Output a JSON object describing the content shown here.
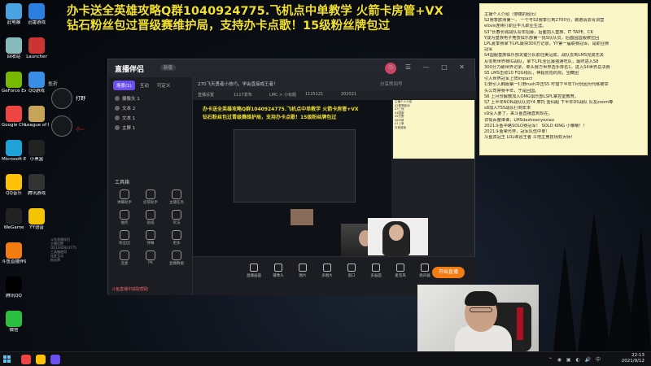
{
  "overlay": {
    "line1": "办卡送全英雄攻略Q群1040924775.飞机点中单教学 火箭卡房管+VX",
    "line2": "钻石粉丝包过晋级赛维护局，支持办卡点歌！15级粉丝牌包过"
  },
  "desktop_icons": [
    {
      "label": "此电脑",
      "color": "#4aa3e0"
    },
    {
      "label": "回收站",
      "color": "#8bb"
    },
    {
      "label": "GeForce Experience",
      "color": "#76b900"
    },
    {
      "label": "Google Chrome",
      "color": "#e44"
    },
    {
      "label": "Microsoft Edge",
      "color": "#1fa2d8"
    },
    {
      "label": "QQ音乐",
      "color": "#ffc107"
    },
    {
      "label": "WeGame",
      "color": "#222"
    },
    {
      "label": "斗鱼直播伴侣",
      "color": "#f27b12"
    },
    {
      "label": "腾讯QQ",
      "color": "#000"
    },
    {
      "label": "微信",
      "color": "#2bbd3f"
    }
  ],
  "desktop_icons_col2": [
    {
      "label": "迅雷游戏",
      "color": "#2a7fe0"
    },
    {
      "label": "Launcher",
      "color": "#c33"
    },
    {
      "label": "QQ游戏",
      "color": "#3a8ee6"
    },
    {
      "label": "League of Legends",
      "color": "#c8a45a"
    },
    {
      "label": "小黑盒",
      "color": "#222"
    },
    {
      "label": "腾讯游戏",
      "color": "#333"
    },
    {
      "label": "YY语音",
      "color": "#f5c400"
    }
  ],
  "float_badge": {
    "label1": "挫折",
    "label2": "打野",
    "label3": "小~"
  },
  "app": {
    "logo": "直播伴侣",
    "version": "新版",
    "tabs": [
      "场景(1)",
      "互动",
      "可定义"
    ],
    "scenes": [
      "摄像头 1",
      "文本 2",
      "文本 1",
      "主屏 1"
    ],
    "tools_title": "工具箱",
    "tools": [
      "弹幕助手",
      "房管助手",
      "主播任务",
      "抽奖",
      "贴纸",
      "玩法",
      "粉丝团",
      "弹幕",
      "更多",
      "连麦",
      "PK",
      "直播数据"
    ],
    "notice": "斗鱼直播中获取帮助",
    "top_title": "270飞天勇者小技巧，学会直接成王者！",
    "top_search": "分享房间号",
    "sub_items": [
      "直播设置",
      "1117发布",
      "LMC > 小标题",
      "1125121",
      "202021"
    ],
    "preview_line1": "办卡送全英雄攻略Q群1040924775.飞机点中单教学 火箭卡房管+VX",
    "preview_line2": "钻石粉丝包过晋级赛维护局，支持办卡点歌！15级粉丝牌包过",
    "notes_lines": [
      "主播个人介绍",
      "S2赛季欧洲",
      "S3三冠",
      "S4国服",
      "S5打野",
      "S6中单",
      "S7上单",
      "抖音搜索"
    ],
    "bottom_items": [
      "直播画面",
      "摄像头",
      "图片",
      "多图片",
      "窗口",
      "多画面",
      "麦克风",
      "扬声器"
    ],
    "start_label": "开始直播"
  },
  "ghost_panel": [
    "斗鱼直播伴侣",
    "主播设置",
    "QQ1040924775",
    "工具箱使用",
    "连麦互动",
    "粉丝牌"
  ],
  "sticky": {
    "lines": [
      "主播个人介绍（惨痛的经历）",
      "S2赛季欧洲第一，  一个号S2赛季打到2700分，被邀请去青训营",
      "elove连续打职业平凡职业生涯。",
      "S3“长春长城战队青年招募，后面加入皇族、IT TAPE、CK",
      "Y成为皇族电子竞技俱乐部第一批S队队员，后面因国服被拉回",
      "LPL夏季赛拿下LPL最快300万记录。YY第一届联赛冠军，是职业赛",
      "冠军",
      "S4国服皇族俱乐部关键分队前往美冠成，战队去到LMS完成无关",
      "从零到世界赛IG战队，拿下LPL全区最强通吃队，最终进入S8",
      "300分力破世界记录，单头赛方世界选手排名1，进入S4世界总决赛",
      "S5 LMS击败10 FQG线队，神超冒险的局，宝藏团",
      "引入世界冠军上阵impact",
      "打野引入韩服第一打野rush冲击S5 可惜下半年7月份因为代练被举",
      "头公司禁赛半年，于是回国。",
      "S6 上月份解散加入OMG俱乐部LSPL掌控室教育。",
      "S7 上半年NON战队队员Y4 摩托 金仙超 下半年DS战队 队友zoom等",
      "s8加入TS5战队打到年末",
      "s9没人要了，来斗鱼直播直到现在。",
      "详情百度谁谁，LMSdasheanyoxiao",
      "2021斗鱼中路SOLO赛冠军！ SOLO KING 小雏菊！！",
      "2021斗鱼荣光杯，冠军队伍中单！",
      "斗鱼双冠王 LOL峡谷王者 斗地主竞技场双大师！"
    ]
  },
  "taskbar": {
    "time": "22:13",
    "date": "2021/9/12"
  },
  "colors": {
    "overlay_text": "#f0e030",
    "accent": "#6b4ff0",
    "start_button": "#f27b12",
    "sticky_bg": "#fbf6c8"
  }
}
